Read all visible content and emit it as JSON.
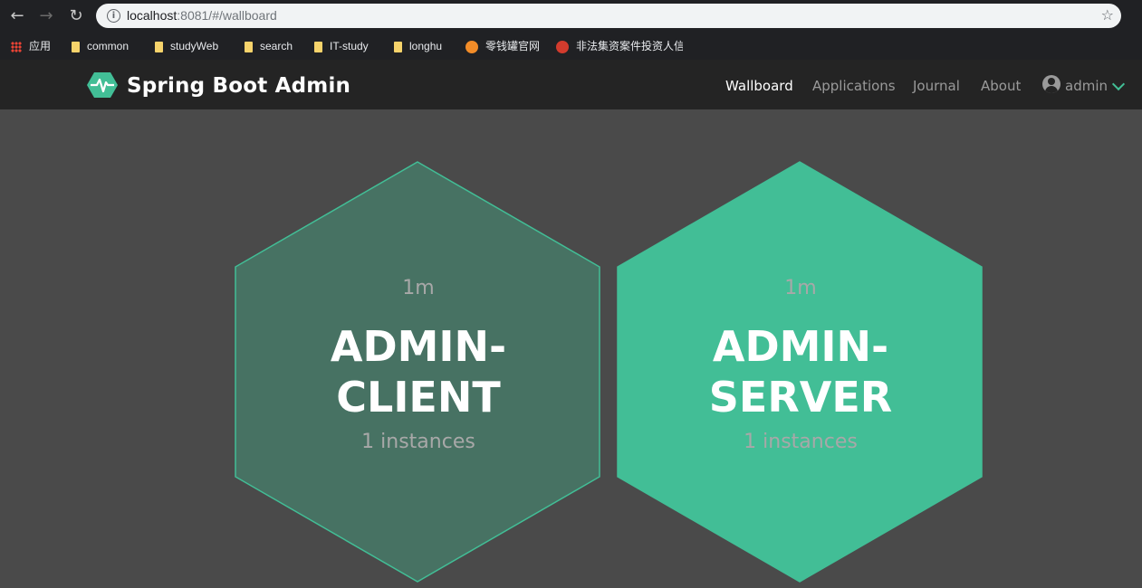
{
  "browser": {
    "url_host": "localhost",
    "url_path": ":8081/#/wallboard"
  },
  "bookmarks": [
    {
      "label": "应用",
      "icon": "apps-grid-icon"
    },
    {
      "label": "common",
      "icon": "folder-icon"
    },
    {
      "label": "studyWeb",
      "icon": "folder-icon"
    },
    {
      "label": "search",
      "icon": "folder-icon"
    },
    {
      "label": "IT-study",
      "icon": "folder-icon"
    },
    {
      "label": "longhu",
      "icon": "folder-icon"
    },
    {
      "label": "零钱罐官网",
      "icon": "site-icon"
    },
    {
      "label": "非法集资案件投资人信",
      "icon": "police-badge-icon"
    }
  ],
  "app": {
    "brand": "Spring Boot Admin",
    "accent_color": "#42be96",
    "nav": [
      {
        "label": "Wallboard",
        "active": true
      },
      {
        "label": "Applications",
        "active": false
      },
      {
        "label": "Journal",
        "active": false
      },
      {
        "label": "About",
        "active": false
      }
    ],
    "user": "admin"
  },
  "wallboard": [
    {
      "time": "1m",
      "name_line1": "ADMIN-",
      "name_line2": "CLIENT",
      "instances": "1 instances",
      "fill": "#477263",
      "stroke": "#42be96"
    },
    {
      "time": "1m",
      "name_line1": "ADMIN-",
      "name_line2": "SERVER",
      "instances": "1 instances",
      "fill": "#42be96",
      "stroke": "#42be96"
    }
  ]
}
